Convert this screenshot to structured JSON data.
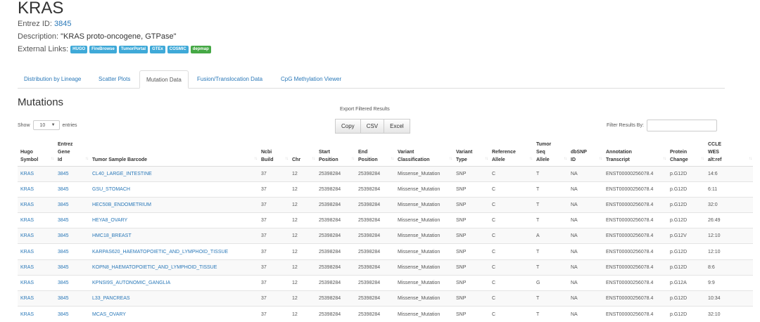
{
  "gene": {
    "symbol": "KRAS",
    "entrez_label": "Entrez ID:",
    "entrez_id": "3845",
    "description_label": "Description:",
    "description": "\"KRAS proto-oncogene, GTPase\"",
    "external_links_label": "External Links:",
    "external_links": [
      "HUGO",
      "FireBrowse",
      "TumorPortal",
      "GTEx",
      "COSMIC",
      "depmap"
    ]
  },
  "colors": {
    "link": "#2a78b8",
    "badge_blue": "#3fa9d8",
    "badge_green": "#45a845"
  },
  "tabs": [
    {
      "label": "Distribution by Lineage"
    },
    {
      "label": "Scatter Plots"
    },
    {
      "label": "Mutation Data",
      "active": true
    },
    {
      "label": "Fusion/Translocation Data"
    },
    {
      "label": "CpG Methylation Viewer"
    }
  ],
  "section": {
    "title": "Mutations",
    "export_label": "Export Filtered Results",
    "export_buttons": [
      "Copy",
      "CSV",
      "Excel"
    ],
    "show_label": "Show",
    "entries_value": "10",
    "entries_label": "entries",
    "filter_label": "Filter Results By:",
    "filter_value": ""
  },
  "table": {
    "columns": [
      [
        "Hugo",
        "Symbol"
      ],
      [
        "Entrez",
        "Gene",
        "Id"
      ],
      [
        "Tumor Sample Barcode"
      ],
      [
        "Ncbi",
        "Build"
      ],
      [
        "Chr"
      ],
      [
        "Start",
        "Position"
      ],
      [
        "End",
        "Position"
      ],
      [
        "Variant",
        "Classification"
      ],
      [
        "Variant",
        "Type"
      ],
      [
        "Reference",
        "Allele"
      ],
      [
        "Tumor",
        "Seq",
        "Allele"
      ],
      [
        "dbSNP",
        "ID"
      ],
      [
        "Annotation",
        "Transcript"
      ],
      [
        "Protein",
        "Change"
      ],
      [
        "CCLE",
        "WES",
        "alt:ref"
      ]
    ],
    "rows": [
      [
        "KRAS",
        "3845",
        "CL40_LARGE_INTESTINE",
        "37",
        "12",
        "25398284",
        "25398284",
        "Missense_Mutation",
        "SNP",
        "C",
        "T",
        "NA",
        "ENST00000256078.4",
        "p.G12D",
        "14:6"
      ],
      [
        "KRAS",
        "3845",
        "GSU_STOMACH",
        "37",
        "12",
        "25398284",
        "25398284",
        "Missense_Mutation",
        "SNP",
        "C",
        "T",
        "NA",
        "ENST00000256078.4",
        "p.G12D",
        "6:11"
      ],
      [
        "KRAS",
        "3845",
        "HEC50B_ENDOMETRIUM",
        "37",
        "12",
        "25398284",
        "25398284",
        "Missense_Mutation",
        "SNP",
        "C",
        "T",
        "NA",
        "ENST00000256078.4",
        "p.G12D",
        "32:0"
      ],
      [
        "KRAS",
        "3845",
        "HEYA8_OVARY",
        "37",
        "12",
        "25398284",
        "25398284",
        "Missense_Mutation",
        "SNP",
        "C",
        "T",
        "NA",
        "ENST00000256078.4",
        "p.G12D",
        "26:49"
      ],
      [
        "KRAS",
        "3845",
        "HMC18_BREAST",
        "37",
        "12",
        "25398284",
        "25398284",
        "Missense_Mutation",
        "SNP",
        "C",
        "A",
        "NA",
        "ENST00000256078.4",
        "p.G12V",
        "12:10"
      ],
      [
        "KRAS",
        "3845",
        "KARPAS620_HAEMATOPOIETIC_AND_LYMPHOID_TISSUE",
        "37",
        "12",
        "25398284",
        "25398284",
        "Missense_Mutation",
        "SNP",
        "C",
        "T",
        "NA",
        "ENST00000256078.4",
        "p.G12D",
        "12:10"
      ],
      [
        "KRAS",
        "3845",
        "KOPN8_HAEMATOPOIETIC_AND_LYMPHOID_TISSUE",
        "37",
        "12",
        "25398284",
        "25398284",
        "Missense_Mutation",
        "SNP",
        "C",
        "T",
        "NA",
        "ENST00000256078.4",
        "p.G12D",
        "8:6"
      ],
      [
        "KRAS",
        "3845",
        "KPNSI9S_AUTONOMIC_GANGLIA",
        "37",
        "12",
        "25398284",
        "25398284",
        "Missense_Mutation",
        "SNP",
        "C",
        "G",
        "NA",
        "ENST00000256078.4",
        "p.G12A",
        "9:9"
      ],
      [
        "KRAS",
        "3845",
        "L33_PANCREAS",
        "37",
        "12",
        "25398284",
        "25398284",
        "Missense_Mutation",
        "SNP",
        "C",
        "T",
        "NA",
        "ENST00000256078.4",
        "p.G12D",
        "10:34"
      ],
      [
        "KRAS",
        "3845",
        "MCAS_OVARY",
        "37",
        "12",
        "25398284",
        "25398284",
        "Missense_Mutation",
        "SNP",
        "C",
        "T",
        "NA",
        "ENST00000256078.4",
        "p.G12D",
        "32:10"
      ]
    ]
  }
}
